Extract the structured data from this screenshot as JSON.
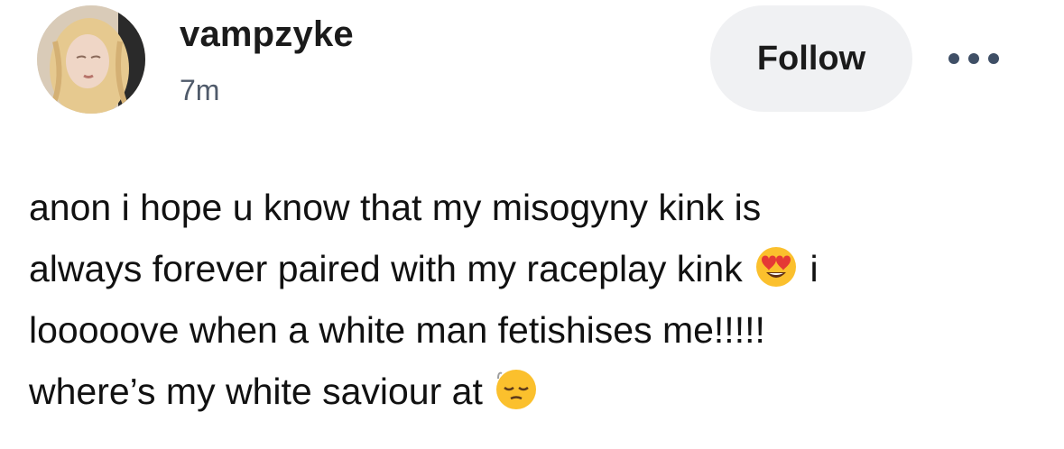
{
  "post": {
    "author": {
      "username": "vampzyke",
      "timestamp": "7m"
    },
    "follow_label": "Follow",
    "more_icon": "more-horizontal-icon",
    "body": {
      "line1": "anon i hope u know that my misogyny kink is",
      "line2_text": "always forever paired with my raceplay kink",
      "line2_emoji": "heart-eyes-emoji",
      "line2_after": "i",
      "line3": "looooove when a white man fetishises me!!!!!",
      "line4_text": "where’s my white saviour at",
      "line4_emoji": "pensive-face-emoji"
    }
  },
  "colors": {
    "text": "#111111",
    "meta": "#4f5a6a",
    "follow_bg": "#f0f1f3",
    "dots": "#3f4f66"
  }
}
